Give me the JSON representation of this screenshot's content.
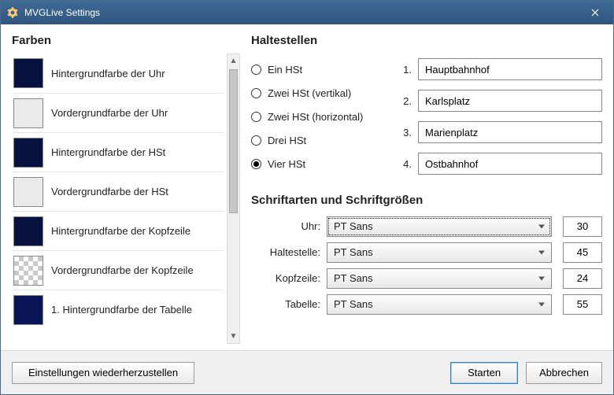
{
  "window": {
    "title": "MVGLive Settings"
  },
  "sections": {
    "colors": "Farben",
    "stops": "Haltestellen",
    "fonts": "Schriftarten und Schriftgrößen"
  },
  "colors": [
    {
      "label": "Hintergrundfarbe der Uhr",
      "value": "#06113f",
      "checker": false
    },
    {
      "label": "Vordergrundfarbe der Uhr",
      "value": "#eaeaea",
      "checker": false
    },
    {
      "label": "Hintergrundfarbe der HSt",
      "value": "#06113f",
      "checker": false
    },
    {
      "label": "Vordergrundfarbe der HSt",
      "value": "#eaeaea",
      "checker": false
    },
    {
      "label": "Hintergrundfarbe der Kopfzeile",
      "value": "#06113f",
      "checker": false
    },
    {
      "label": "Vordergrundfarbe der Kopfzeile",
      "value": "",
      "checker": true
    },
    {
      "label": "1. Hintergrundfarbe der Tabelle",
      "value": "#0a1556",
      "checker": false
    }
  ],
  "stop_count": {
    "options": [
      {
        "label": "Ein HSt",
        "value": 1,
        "checked": false
      },
      {
        "label": "Zwei HSt (vertikal)",
        "value": 2,
        "checked": false
      },
      {
        "label": "Zwei HSt (horizontal)",
        "value": 2,
        "checked": false
      },
      {
        "label": "Drei HSt",
        "value": 3,
        "checked": false
      },
      {
        "label": "Vier HSt",
        "value": 4,
        "checked": true
      }
    ]
  },
  "stops": [
    {
      "num": "1.",
      "value": "Hauptbahnhof"
    },
    {
      "num": "2.",
      "value": "Karlsplatz"
    },
    {
      "num": "3.",
      "value": "Marienplatz"
    },
    {
      "num": "4.",
      "value": "Ostbahnhof"
    }
  ],
  "fonts": [
    {
      "label": "Uhr:",
      "family": "PT Sans",
      "size": "30",
      "focused": true
    },
    {
      "label": "Haltestelle:",
      "family": "PT Sans",
      "size": "45",
      "focused": false
    },
    {
      "label": "Kopfzeile:",
      "family": "PT Sans",
      "size": "24",
      "focused": false
    },
    {
      "label": "Tabelle:",
      "family": "PT Sans",
      "size": "55",
      "focused": false
    }
  ],
  "buttons": {
    "reset": "Einstellungen wiederherzustellen",
    "start": "Starten",
    "cancel": "Abbrechen"
  }
}
